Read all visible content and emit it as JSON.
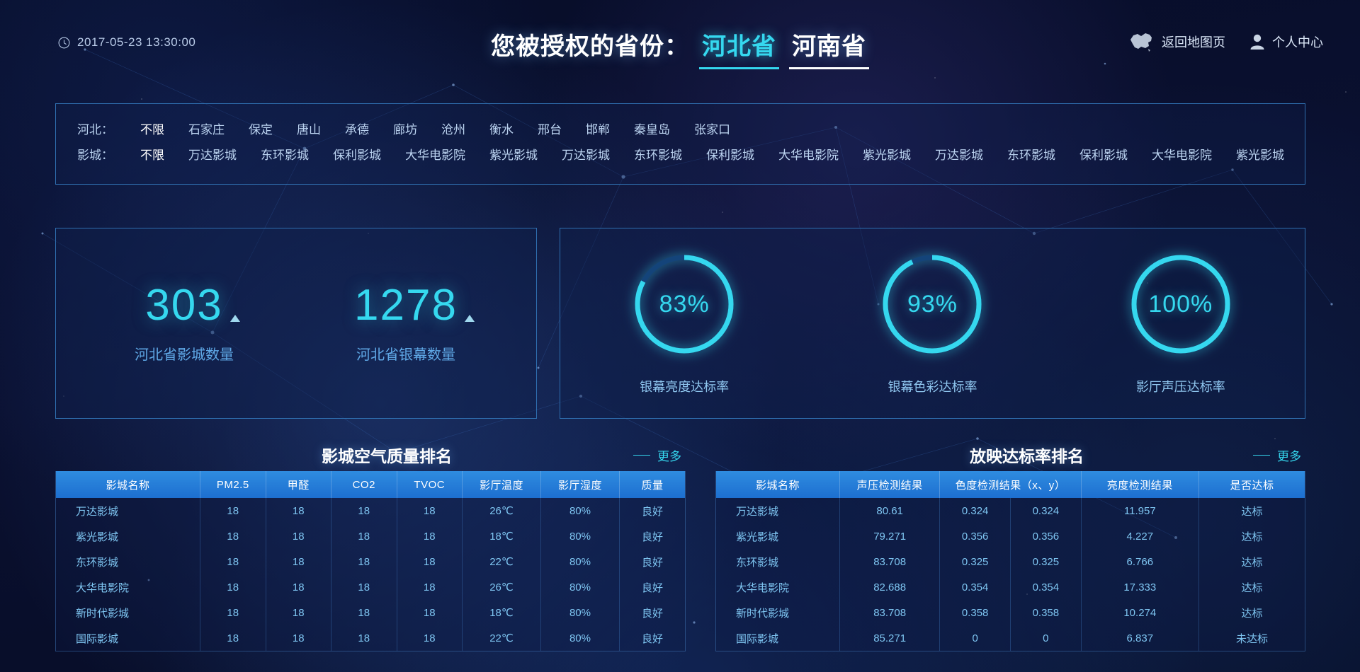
{
  "header": {
    "clock_icon": "clock-icon",
    "datetime": "2017-05-23  13:30:00",
    "title_prefix": "您被授权的省份：",
    "provinces": [
      {
        "label": "河北省",
        "active": true
      },
      {
        "label": "河南省",
        "active": false
      }
    ],
    "actions": [
      {
        "icon": "china-map-icon",
        "label": "返回地图页"
      },
      {
        "icon": "user-icon",
        "label": "个人中心"
      }
    ]
  },
  "filter": {
    "rows": [
      {
        "label": "河北：",
        "options": [
          "不限",
          "石家庄",
          "保定",
          "唐山",
          "承德",
          "廊坊",
          "沧州",
          "衡水",
          "邢台",
          "邯郸",
          "秦皇岛",
          "张家口"
        ],
        "active_index": 0
      },
      {
        "label": "影城：",
        "options": [
          "不限",
          "万达影城",
          "东环影城",
          "保利影城",
          "大华电影院",
          "紫光影城",
          "万达影城",
          "东环影城",
          "保利影城",
          "大华电影院",
          "紫光影城",
          "万达影城",
          "东环影城",
          "保利影城",
          "大华电影院",
          "紫光影城"
        ],
        "active_index": 0
      }
    ]
  },
  "stats": [
    {
      "value": "303",
      "label": "河北省影城数量",
      "trend": "up"
    },
    {
      "value": "1278",
      "label": "河北省银幕数量",
      "trend": "up"
    }
  ],
  "gauges": [
    {
      "value": 83,
      "value_label": "83%",
      "label": "银幕亮度达标率"
    },
    {
      "value": 93,
      "value_label": "93%",
      "label": "银幕色彩达标率"
    },
    {
      "value": 100,
      "value_label": "100%",
      "label": "影厅声压达标率"
    }
  ],
  "air_quality": {
    "title": "影城空气质量排名",
    "more_label": "更多",
    "columns": [
      "影城名称",
      "PM2.5",
      "甲醛",
      "CO2",
      "TVOC",
      "影厅温度",
      "影厅湿度",
      "质量"
    ],
    "rows": [
      [
        "万达影城",
        "18",
        "18",
        "18",
        "18",
        "26℃",
        "80%",
        "良好"
      ],
      [
        "紫光影城",
        "18",
        "18",
        "18",
        "18",
        "18℃",
        "80%",
        "良好"
      ],
      [
        "东环影城",
        "18",
        "18",
        "18",
        "18",
        "22℃",
        "80%",
        "良好"
      ],
      [
        "大华电影院",
        "18",
        "18",
        "18",
        "18",
        "26℃",
        "80%",
        "良好"
      ],
      [
        "新时代影城",
        "18",
        "18",
        "18",
        "18",
        "18℃",
        "80%",
        "良好"
      ],
      [
        "国际影城",
        "18",
        "18",
        "18",
        "18",
        "22℃",
        "80%",
        "良好"
      ]
    ]
  },
  "projection": {
    "title": "放映达标率排名",
    "more_label": "更多",
    "columns": [
      "影城名称",
      "声压检测结果",
      "色度检测结果（x、y）",
      "",
      "亮度检测结果",
      "是否达标"
    ],
    "rows": [
      [
        "万达影城",
        "80.61",
        "0.324",
        "0.324",
        "11.957",
        "达标"
      ],
      [
        "紫光影城",
        "79.271",
        "0.356",
        "0.356",
        "4.227",
        "达标"
      ],
      [
        "东环影城",
        "83.708",
        "0.325",
        "0.325",
        "6.766",
        "达标"
      ],
      [
        "大华电影院",
        "82.688",
        "0.354",
        "0.354",
        "17.333",
        "达标"
      ],
      [
        "新时代影城",
        "83.708",
        "0.358",
        "0.358",
        "10.274",
        "达标"
      ],
      [
        "国际影城",
        "85.271",
        "0",
        "0",
        "6.837",
        "未达标"
      ]
    ]
  },
  "colors": {
    "accent": "#35d8ef",
    "panel_border": "#2f6fb0",
    "table_header": "#1d6fd0",
    "background": "#050a22",
    "text": "#7fc6f2"
  }
}
